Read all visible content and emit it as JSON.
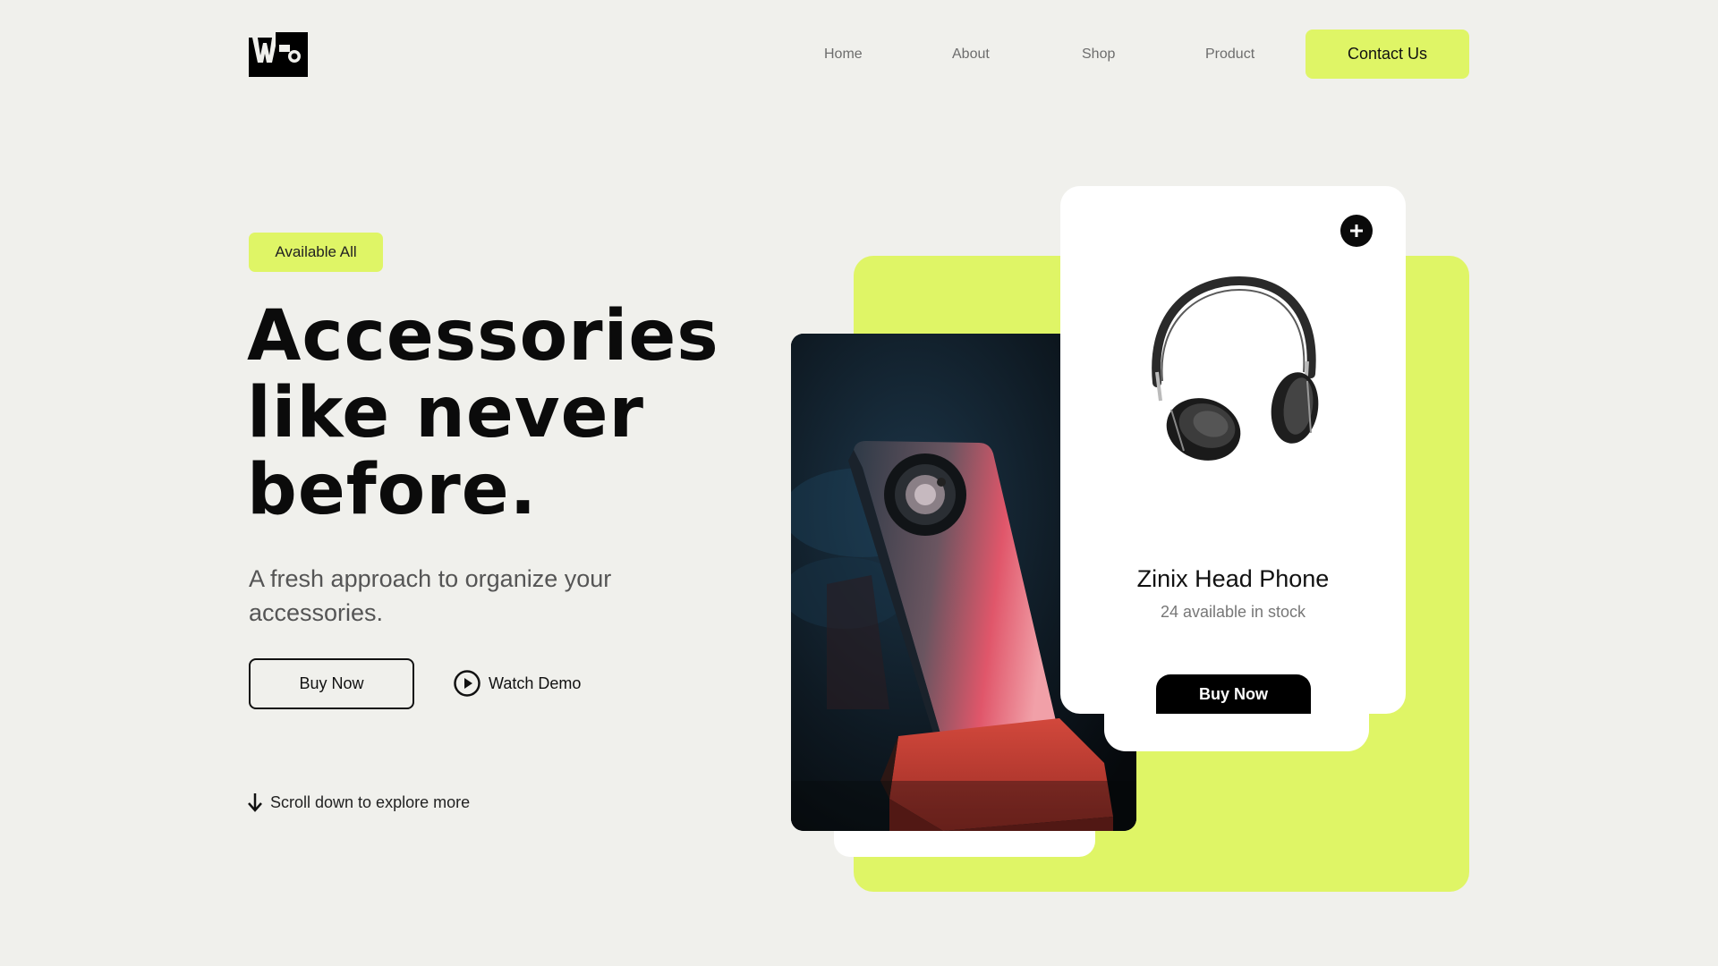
{
  "brand": {
    "logo_name": "wp-logo"
  },
  "nav": {
    "items": [
      {
        "label": "Home"
      },
      {
        "label": "About"
      },
      {
        "label": "Shop"
      },
      {
        "label": "Product"
      }
    ],
    "contact_label": "Contact Us"
  },
  "hero": {
    "badge": "Available All",
    "headline": [
      "Accessories",
      "like never",
      "before."
    ],
    "subtext": "A fresh approach to organize your accessories.",
    "buy_label": "Buy Now",
    "demo_label": "Watch Demo",
    "scroll_hint": "Scroll down to explore more"
  },
  "product": {
    "name": "Zinix Head Phone",
    "stock": "24 available in stock",
    "buy_label": "Buy Now",
    "add_icon": "plus-icon"
  },
  "colors": {
    "accent": "#dff566",
    "background": "#f0f0ec",
    "dark": "#0a0a0a",
    "card": "#ffffff"
  }
}
